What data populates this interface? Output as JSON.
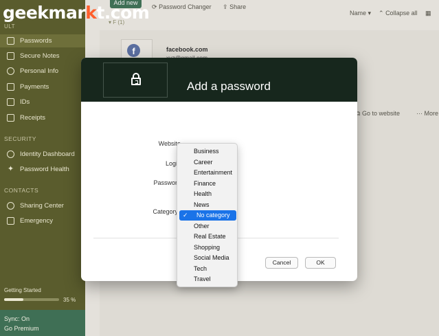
{
  "watermark": {
    "part1": "geekmar",
    "part2": "k",
    "part3": "t.com"
  },
  "sidebar": {
    "vault_label": "ULT",
    "items": [
      {
        "label": "Passwords",
        "icon": "lock-icon"
      },
      {
        "label": "Secure Notes",
        "icon": "note-icon"
      },
      {
        "label": "Personal Info",
        "icon": "person-icon"
      },
      {
        "label": "Payments",
        "icon": "card-icon"
      },
      {
        "label": "IDs",
        "icon": "id-icon"
      },
      {
        "label": "Receipts",
        "icon": "receipt-icon"
      }
    ],
    "security_label": "SECURITY",
    "security_items": [
      {
        "label": "Identity Dashboard",
        "icon": "eye-icon"
      },
      {
        "label": "Password Health",
        "icon": "pulse-icon"
      }
    ],
    "contacts_label": "CONTACTS",
    "contacts_items": [
      {
        "label": "Sharing Center",
        "icon": "share-icon"
      },
      {
        "label": "Emergency",
        "icon": "emergency-icon"
      }
    ],
    "getting_started": {
      "label": "Getting Started",
      "percent_label": "35 %",
      "progress": 0.35
    },
    "sync_status": "Sync: On",
    "premium": "Go Premium"
  },
  "topbar": {
    "add_new": "Add new",
    "password_changer": "Password Changer",
    "share": "Share",
    "sort": "Name ▾",
    "collapse": "Collapse all",
    "folder_chip": "▾ F (1)"
  },
  "list": {
    "site_name": "facebook.com",
    "site_user": "xyz@gmail.com",
    "avatar_letter": "f"
  },
  "detail_actions": {
    "go_to_website": "Go to website",
    "more": "More"
  },
  "dialog": {
    "title": "Add a password",
    "fields": {
      "website": "Website",
      "login": "Login",
      "password": "Password",
      "category": "Category"
    },
    "cancel": "Cancel",
    "ok": "OK"
  },
  "dropdown": {
    "options": [
      "Business",
      "Career",
      "Entertainment",
      "Finance",
      "Health",
      "News",
      "No category",
      "Other",
      "Real Estate",
      "Shopping",
      "Social Media",
      "Tech",
      "Travel"
    ],
    "selected": "No category",
    "accent_color": "#1a73e8"
  }
}
